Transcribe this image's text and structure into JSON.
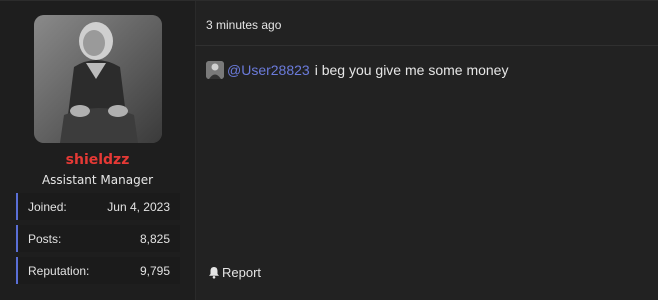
{
  "user": {
    "name": "shieldzz",
    "title": "Assistant Manager",
    "name_color": "#e53935"
  },
  "stats": [
    {
      "label": "Joined:",
      "value": "Jun 4, 2023"
    },
    {
      "label": "Posts:",
      "value": "8,825"
    },
    {
      "label": "Reputation:",
      "value": "9,795"
    }
  ],
  "post": {
    "timestamp": "3 minutes ago",
    "mention": "@User28823",
    "text": "i beg you give me some money",
    "mention_color": "#6b7bdb"
  },
  "actions": {
    "report_label": "Report",
    "report_icon": "bell-icon"
  },
  "colors": {
    "stat_accent": "#5a6fd6",
    "background": "#222222"
  }
}
